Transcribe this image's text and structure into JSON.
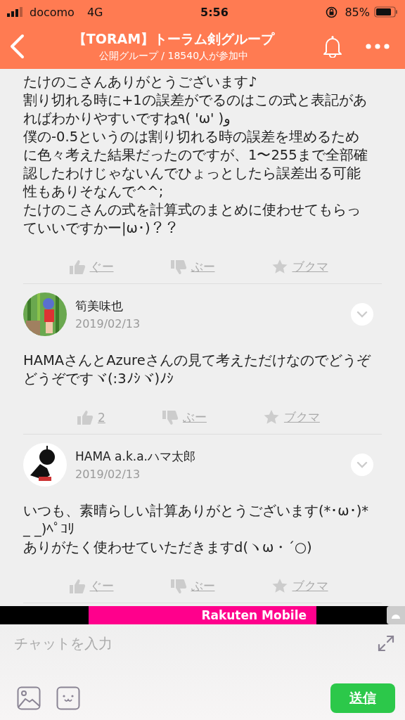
{
  "status_bar": {
    "carrier": "docomo",
    "network": "4G",
    "time": "5:56",
    "battery": "85%"
  },
  "header": {
    "title": "【TORAM】トーラム剣グループ",
    "subtitle": "公開グループ / 18540人が参加中"
  },
  "posts": [
    {
      "paragraphs": [
        "たけのこさんありがとうございます♪",
        "割り切れる時に+1の誤差がでるのはこの式と表記があればわかりやすいですね٩( 'ω' )و",
        "僕の-0.5というのは割り切れる時の誤差を埋めるために色々考えた結果だったのですが、1〜255まで全部確認したわけじゃないんでひょっとしたら誤差出る可能性もありそなんで^^;",
        "たけのこさんの式を計算式のまとめに使わせてもらっていいですかー|ω･)？？"
      ],
      "reactions": {
        "good": "ぐー",
        "bad": "ぶー",
        "bookmark": "ブクマ"
      }
    },
    {
      "author": "筍美味也",
      "date": "2019/02/13",
      "avatar": {
        "kind": "picture"
      },
      "paragraphs": [
        "HAMAさんとAzureさんの見て考えただけなのでどうぞどうぞですヾ(:3ﾉｼヾ)ﾉｼ"
      ],
      "reactions": {
        "good": "2",
        "bad": "ぶー",
        "bookmark": "ブクマ"
      }
    },
    {
      "author": "HAMA a.k.a.ハマ太郎",
      "date": "2019/02/13",
      "avatar": {
        "kind": "picture"
      },
      "paragraphs": [
        "いつも、素晴らしい計算ありがとうございます(*･ω･)*_ _)ﾍﾟｺﾘ",
        "ありがたく使わせていただきますd(ヽω・´○)"
      ],
      "reactions": {
        "good": "ぐー",
        "bad": "ぶー",
        "bookmark": "ブクマ"
      }
    }
  ],
  "ad": {
    "brand": "Rakuten Mobile"
  },
  "composer": {
    "placeholder": "チャットを入力",
    "send": "送信"
  }
}
